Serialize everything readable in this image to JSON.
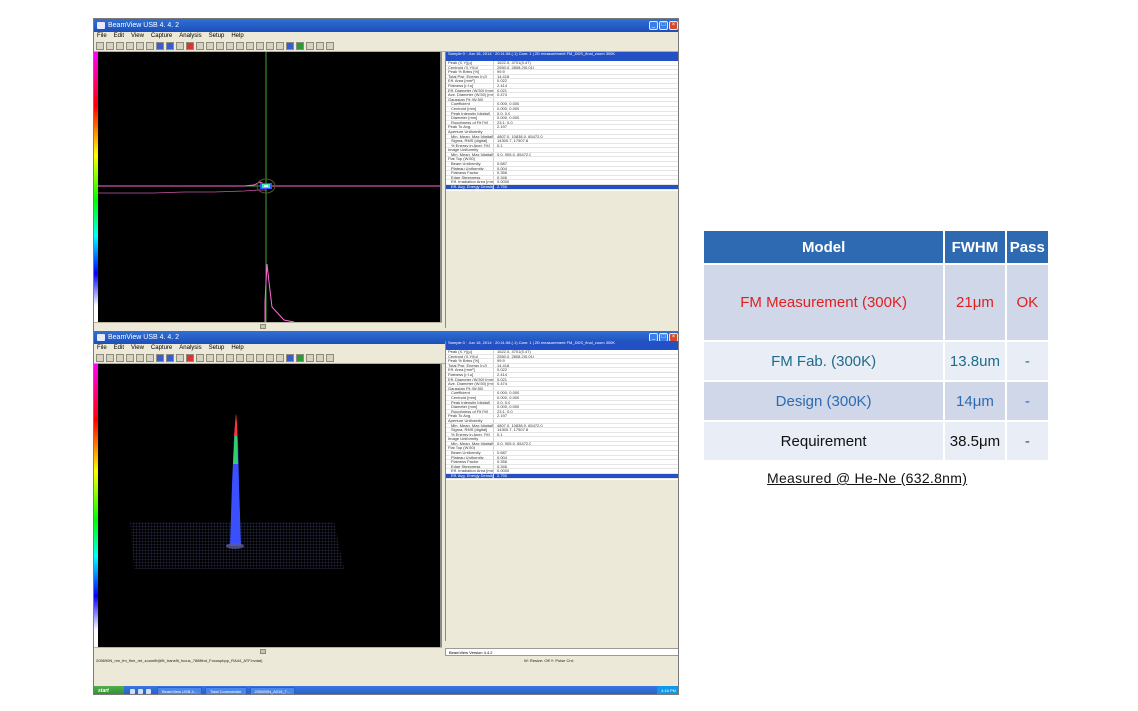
{
  "app": {
    "window_title": "BeamView USB 4. 4. 2",
    "menu": [
      "File",
      "Edit",
      "View",
      "Capture",
      "Analysis",
      "Setup",
      "Help"
    ]
  },
  "results": {
    "header": "Sample 0 · Jun 16, 2014 · 20:11:58 (.1)     Cam: 1  |  2D measurement  FM_DDS_final_zoom  300K",
    "rows": [
      {
        "k": "Peak (X,Y)[μ]",
        "v": "1622.0, 4701(0.47)"
      },
      {
        "k": "Centroid (X,Y)[μ]",
        "v": "2550.0, 2808.2(0.01)"
      },
      {
        "k": "Peak % Brtns [%]",
        "v": "99.9"
      },
      {
        "k": "Total Pwr. Energy [nJ]",
        "v": "14.418"
      },
      {
        "k": "Eff. Area [mm²]",
        "v": "0.022"
      },
      {
        "k": "Flatness [r.f.u]",
        "v": "2.414"
      },
      {
        "k": "Eff. Diameter (W.50) [mm]",
        "v": "0.021"
      },
      {
        "k": "Ave. Diameter (W.50) [mm]",
        "v": "0.474"
      },
      {
        "k": "Gaussian Fit (W.50)",
        "v": ""
      },
      {
        "k": "Coefficient",
        "v": "0.000, 0.000",
        "indent": true
      },
      {
        "k": "Centroid [mm]",
        "v": "0.000, 0.000",
        "indent": true
      },
      {
        "k": "Peak Intensity [digital]",
        "v": "0.0, 0.0",
        "indent": true
      },
      {
        "k": "Diameter [mm]",
        "v": "0.000, 0.000",
        "indent": true
      },
      {
        "k": "Roughness of Fit [%]",
        "v": "23.1, 0.0",
        "indent": true
      },
      {
        "k": "Peak To Avg.",
        "v": "2.197"
      },
      {
        "k": "Aperture Uniformity",
        "v": ""
      },
      {
        "k": "Min. Mean, Max [digital]",
        "v": "4807.0, 10838.0, 65472.0",
        "indent": true
      },
      {
        "k": "Sigma, RMS [digital]",
        "v": "14300.7, 17507.8",
        "indent": true
      },
      {
        "k": "% Energy in Aper. [%]",
        "v": "0.1",
        "indent": true
      },
      {
        "k": "Image Uniformity",
        "v": ""
      },
      {
        "k": "Min. Mean, Max [digital]",
        "v": "0.0, 905.0, 65472.0",
        "indent": true
      },
      {
        "k": "Flat Top (W.50)",
        "v": ""
      },
      {
        "k": "Beam Uniformity",
        "v": "0.687",
        "indent": true
      },
      {
        "k": "Plateau Uniformity",
        "v": "0.004",
        "indent": true
      },
      {
        "k": "Flatness Factor",
        "v": "0.356",
        "indent": true
      },
      {
        "k": "Edge Steepness",
        "v": "0.346",
        "indent": true
      },
      {
        "k": "Eff. Irradiation Area [mm]",
        "v": "0.0000",
        "indent": true
      },
      {
        "k": "Eff. Avg. Energy Density [J/cm²]",
        "v": "2.750",
        "indent": true,
        "sel": true
      }
    ],
    "version_label": "BeamView Version   4.4.2"
  },
  "status": {
    "path": "205690N_nm_fm_fine_ret_zoomfit@fit_transfit_focus_788ffind_Focuspbpp_RA44_ATF.bvdat)",
    "resize": "W: Resize: Off    Y:     Pulse Cnt:"
  },
  "taskbar": {
    "start": "start",
    "tasks": [
      "BeamView USB 4...",
      "Total Commander",
      "205690N_A016_T..."
    ],
    "tray": "4:16 PM"
  },
  "table": {
    "headers": [
      "Model",
      "FWHM",
      "Pass"
    ],
    "rows": [
      {
        "model": "FM Measurement (300K)",
        "fwhm": "21μm",
        "pass": "OK"
      },
      {
        "model": "FM Fab. (300K)",
        "fwhm": "13.8um",
        "pass": "-"
      },
      {
        "model": "Design (300K)",
        "fwhm": "14μm",
        "pass": "-"
      },
      {
        "model": "Requirement",
        "fwhm": "38.5μm",
        "pass": "-"
      }
    ]
  },
  "note": "Measured @ He-Ne (632.8nm)",
  "colors": {
    "table_header": "#2e6ab1",
    "measurement_text": "#e02020",
    "fab_text": "#1e6b8c",
    "design_text": "#2e6ab1",
    "crosshair": "#3aa83a",
    "profile": "#ff6ad5"
  }
}
